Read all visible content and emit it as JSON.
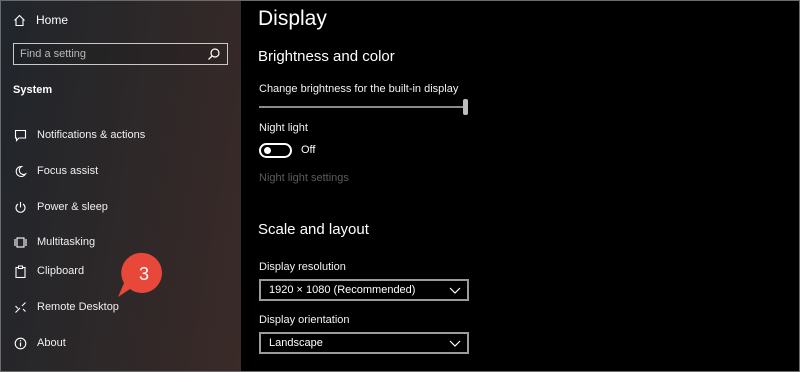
{
  "sidebar": {
    "home_label": "Home",
    "search_placeholder": "Find a setting",
    "section_label": "System",
    "items": [
      {
        "label": "Notifications & actions",
        "icon": "notifications-icon"
      },
      {
        "label": "Focus assist",
        "icon": "moon-icon"
      },
      {
        "label": "Power & sleep",
        "icon": "power-icon"
      },
      {
        "label": "Multitasking",
        "icon": "multitasking-icon"
      },
      {
        "label": "Clipboard",
        "icon": "clipboard-icon"
      },
      {
        "label": "Remote Desktop",
        "icon": "remote-desktop-icon"
      },
      {
        "label": "About",
        "icon": "info-icon"
      }
    ]
  },
  "callout": {
    "number": "3",
    "color": "#e8483a"
  },
  "main": {
    "title": "Display",
    "brightness_heading": "Brightness and color",
    "brightness_label": "Change brightness for the built-in display",
    "brightness_value": 1.0,
    "night_light_label": "Night light",
    "night_light_state": "Off",
    "night_light_settings_link": "Night light settings",
    "scale_heading": "Scale and layout",
    "resolution_label": "Display resolution",
    "resolution_value": "1920 × 1080 (Recommended)",
    "orientation_label": "Display orientation",
    "orientation_value": "Landscape"
  }
}
